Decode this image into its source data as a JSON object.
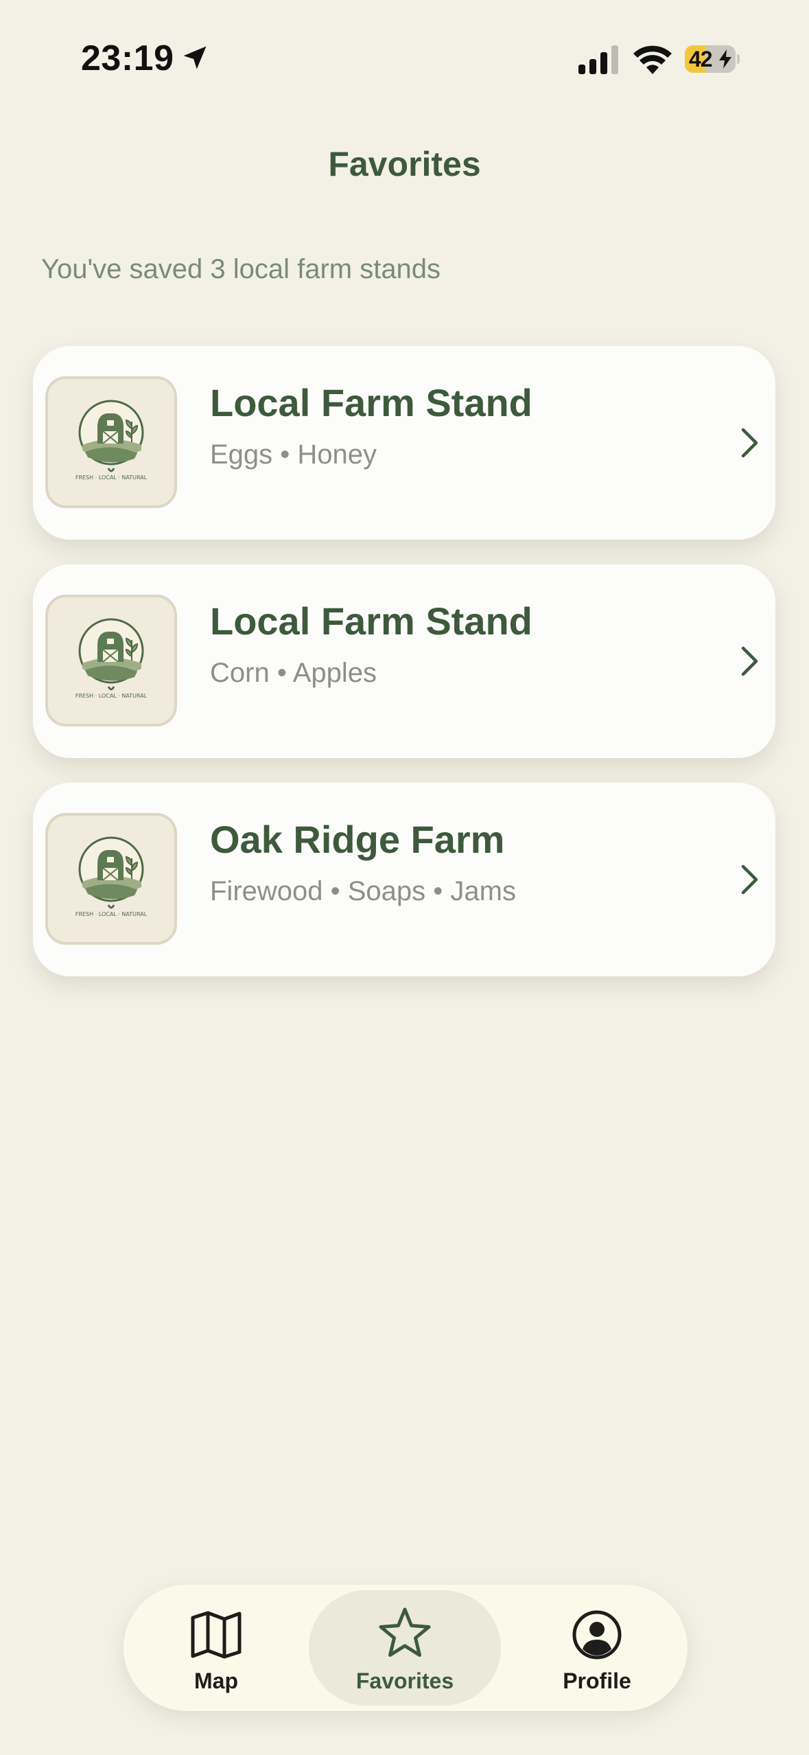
{
  "status": {
    "time": "23:19",
    "battery": "42",
    "battery_level": 0.42
  },
  "header": {
    "title": "Favorites",
    "subtitle": "You've saved 3 local farm stands"
  },
  "favorites": [
    {
      "name": "Local Farm Stand",
      "tags": "Eggs • Honey",
      "logo_text": "FRESH · LOCAL · NATURAL"
    },
    {
      "name": "Local Farm Stand",
      "tags": "Corn • Apples",
      "logo_text": "FRESH · LOCAL · NATURAL"
    },
    {
      "name": "Oak Ridge Farm",
      "tags": "Firewood • Soaps • Jams",
      "logo_text": "FRESH · LOCAL · NATURAL"
    }
  ],
  "tabs": [
    {
      "label": "Map",
      "icon": "map-icon"
    },
    {
      "label": "Favorites",
      "icon": "star-icon",
      "selected": true
    },
    {
      "label": "Profile",
      "icon": "profile-icon"
    }
  ],
  "colors": {
    "background": "#f3f1e6",
    "accent_green": "#3d5a3c",
    "subtitle": "#7a8c74",
    "tag_gray": "#8e8e8a",
    "battery": "#f4c63d"
  }
}
